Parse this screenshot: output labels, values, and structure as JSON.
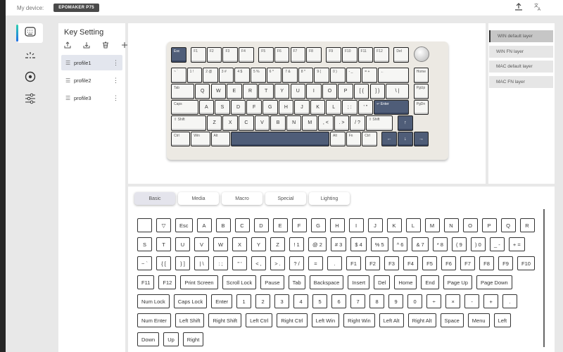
{
  "header": {
    "device_label": "My device:",
    "device_name": "EPOMAKER P75",
    "icons": [
      "upload-icon",
      "translate-icon"
    ]
  },
  "nav": {
    "items": [
      {
        "name": "key-setting",
        "icon": "keyboard-icon",
        "active": true
      },
      {
        "name": "lighting",
        "icon": "light-icon"
      },
      {
        "name": "macro",
        "icon": "record-icon"
      },
      {
        "name": "settings",
        "icon": "sliders-icon"
      }
    ]
  },
  "profiles": {
    "title": "Key Setting",
    "tools": [
      "import-icon",
      "export-icon",
      "delete-icon",
      "add-icon"
    ],
    "items": [
      {
        "label": "profile1",
        "active": true
      },
      {
        "label": "profile2"
      },
      {
        "label": "profile3"
      }
    ]
  },
  "layers": {
    "items": [
      {
        "label": "WIN default layer",
        "active": true
      },
      {
        "label": "WIN FN layer"
      },
      {
        "label": "MAC default layer"
      },
      {
        "label": "MAC FN layer"
      }
    ]
  },
  "keyboard": {
    "rows": [
      [
        {
          "l": "Esc",
          "x": 0,
          "w": 1,
          "dark": true
        },
        {
          "l": "F1",
          "x": 1.25,
          "w": 1
        },
        {
          "l": "F2",
          "x": 2.25,
          "w": 1
        },
        {
          "l": "F3",
          "x": 3.25,
          "w": 1
        },
        {
          "l": "F4",
          "x": 4.25,
          "w": 1
        },
        {
          "l": "F5",
          "x": 5.5,
          "w": 1
        },
        {
          "l": "F6",
          "x": 6.5,
          "w": 1
        },
        {
          "l": "F7",
          "x": 7.5,
          "w": 1
        },
        {
          "l": "F8",
          "x": 8.5,
          "w": 1
        },
        {
          "l": "F9",
          "x": 9.75,
          "w": 1
        },
        {
          "l": "F10",
          "x": 10.75,
          "w": 1
        },
        {
          "l": "F11",
          "x": 11.75,
          "w": 1
        },
        {
          "l": "F12",
          "x": 12.75,
          "w": 1
        },
        {
          "l": "Del",
          "x": 14,
          "w": 1
        }
      ],
      [
        {
          "l": "~ `",
          "x": 0,
          "w": 1
        },
        {
          "l": "1 !",
          "x": 1,
          "w": 1
        },
        {
          "l": "2 @",
          "x": 2,
          "w": 1
        },
        {
          "l": "3 #",
          "x": 3,
          "w": 1
        },
        {
          "l": "4 $",
          "x": 4,
          "w": 1
        },
        {
          "l": "5 %",
          "x": 5,
          "w": 1
        },
        {
          "l": "6 ^",
          "x": 6,
          "w": 1
        },
        {
          "l": "7 &",
          "x": 7,
          "w": 1
        },
        {
          "l": "8 *",
          "x": 8,
          "w": 1
        },
        {
          "l": "9 (",
          "x": 9,
          "w": 1
        },
        {
          "l": "0 )",
          "x": 10,
          "w": 1
        },
        {
          "l": "- _",
          "x": 11,
          "w": 1
        },
        {
          "l": "= +",
          "x": 12,
          "w": 1
        },
        {
          "l": "←",
          "x": 13,
          "w": 2
        },
        {
          "l": "Home",
          "x": 15.25,
          "w": 1
        }
      ],
      [
        {
          "l": "Tab",
          "x": 0,
          "w": 1.5
        },
        {
          "l": "Q",
          "x": 1.5,
          "w": 1,
          "c": true
        },
        {
          "l": "W",
          "x": 2.5,
          "w": 1,
          "c": true
        },
        {
          "l": "E",
          "x": 3.5,
          "w": 1,
          "c": true
        },
        {
          "l": "R",
          "x": 4.5,
          "w": 1,
          "c": true
        },
        {
          "l": "T",
          "x": 5.5,
          "w": 1,
          "c": true
        },
        {
          "l": "Y",
          "x": 6.5,
          "w": 1,
          "c": true
        },
        {
          "l": "U",
          "x": 7.5,
          "w": 1,
          "c": true
        },
        {
          "l": "I",
          "x": 8.5,
          "w": 1,
          "c": true
        },
        {
          "l": "O",
          "x": 9.5,
          "w": 1,
          "c": true
        },
        {
          "l": "P",
          "x": 10.5,
          "w": 1,
          "c": true
        },
        {
          "l": "[ {",
          "x": 11.5,
          "w": 1,
          "c": true
        },
        {
          "l": "] }",
          "x": 12.5,
          "w": 1,
          "c": true
        },
        {
          "l": "\\ |",
          "x": 13.5,
          "w": 1.5,
          "c": true
        },
        {
          "l": "PgUp",
          "x": 15.25,
          "w": 1
        }
      ],
      [
        {
          "l": "Caps",
          "x": 0,
          "w": 1.75
        },
        {
          "l": "A",
          "x": 1.75,
          "w": 1,
          "c": true
        },
        {
          "l": "S",
          "x": 2.75,
          "w": 1,
          "c": true
        },
        {
          "l": "D",
          "x": 3.75,
          "w": 1,
          "c": true
        },
        {
          "l": "F",
          "x": 4.75,
          "w": 1,
          "c": true
        },
        {
          "l": "G",
          "x": 5.75,
          "w": 1,
          "c": true
        },
        {
          "l": "H",
          "x": 6.75,
          "w": 1,
          "c": true
        },
        {
          "l": "J",
          "x": 7.75,
          "w": 1,
          "c": true
        },
        {
          "l": "K",
          "x": 8.75,
          "w": 1,
          "c": true
        },
        {
          "l": "L",
          "x": 9.75,
          "w": 1,
          "c": true
        },
        {
          "l": "; :",
          "x": 10.75,
          "w": 1,
          "c": true
        },
        {
          "l": "' \"",
          "x": 11.75,
          "w": 1,
          "c": true
        },
        {
          "l": "↵ Enter",
          "x": 12.75,
          "w": 2.25,
          "dark": true
        },
        {
          "l": "PgDn",
          "x": 15.25,
          "w": 1
        }
      ],
      [
        {
          "l": "⇧ Shift",
          "x": 0,
          "w": 2.25
        },
        {
          "l": "Z",
          "x": 2.25,
          "w": 1,
          "c": true
        },
        {
          "l": "X",
          "x": 3.25,
          "w": 1,
          "c": true
        },
        {
          "l": "C",
          "x": 4.25,
          "w": 1,
          "c": true
        },
        {
          "l": "V",
          "x": 5.25,
          "w": 1,
          "c": true
        },
        {
          "l": "B",
          "x": 6.25,
          "w": 1,
          "c": true
        },
        {
          "l": "N",
          "x": 7.25,
          "w": 1,
          "c": true
        },
        {
          "l": "M",
          "x": 8.25,
          "w": 1,
          "c": true
        },
        {
          "l": ", <",
          "x": 9.25,
          "w": 1,
          "c": true
        },
        {
          "l": ". >",
          "x": 10.25,
          "w": 1,
          "c": true
        },
        {
          "l": "/ ?",
          "x": 11.25,
          "w": 1,
          "c": true
        },
        {
          "l": "⇧ Shift",
          "x": 12.25,
          "w": 1.75
        },
        {
          "l": "↑",
          "x": 14.25,
          "w": 1,
          "dark": true,
          "c": true
        }
      ],
      [
        {
          "l": "Ctrl",
          "x": 0,
          "w": 1.25
        },
        {
          "l": "Win",
          "x": 1.25,
          "w": 1.25
        },
        {
          "l": "Alt",
          "x": 2.5,
          "w": 1.25
        },
        {
          "l": "",
          "x": 3.75,
          "w": 6.25,
          "dark": true
        },
        {
          "l": "Alt",
          "x": 10,
          "w": 1
        },
        {
          "l": "Fn",
          "x": 11,
          "w": 1
        },
        {
          "l": "Ctrl",
          "x": 12,
          "w": 1
        },
        {
          "l": "←",
          "x": 13.25,
          "w": 1,
          "dark": true,
          "c": true
        },
        {
          "l": "↓",
          "x": 14.25,
          "w": 1,
          "dark": true,
          "c": true
        },
        {
          "l": "→",
          "x": 15.25,
          "w": 1,
          "dark": true,
          "c": true
        }
      ]
    ]
  },
  "keys_panel": {
    "tabs": [
      {
        "label": "Basic",
        "active": true
      },
      {
        "label": "Media"
      },
      {
        "label": "Macro"
      },
      {
        "label": "Special"
      },
      {
        "label": "Lighting"
      }
    ],
    "rows": [
      [
        "",
        "▽",
        "Esc",
        "A",
        "B",
        "C",
        "D",
        "E",
        "F",
        "G",
        "H",
        "I",
        "J",
        "K",
        "L",
        "M",
        "N",
        "O",
        "P",
        "Q",
        "R"
      ],
      [
        "S",
        "T",
        "U",
        "V",
        "W",
        "X",
        "Y",
        "Z",
        "! 1",
        "@ 2",
        "# 3",
        "$ 4",
        "% 5",
        "^ 6",
        "& 7",
        "* 8",
        "( 9",
        ") 0",
        "_ -",
        "+ ="
      ],
      [
        "~ `",
        "{ [",
        "} ]",
        "| \\",
        ": ;",
        "\" '",
        "< ,",
        "> .",
        "? /",
        "=",
        ".",
        "F1",
        "F2",
        "F3",
        "F4",
        "F5",
        "F6",
        "F7",
        "F8",
        "F9",
        "F10"
      ],
      [
        "F11",
        "F12",
        "Print Screen",
        "Scroll Lock",
        "Pause",
        "Tab",
        "Backspace",
        "Insert",
        "Del",
        "Home",
        "End",
        "Page Up",
        "Page Down"
      ],
      [
        "Num Lock",
        "Caps Lock",
        "Enter",
        "1",
        "2",
        "3",
        "4",
        "5",
        "6",
        "7",
        "8",
        "9",
        "0",
        "÷",
        "×",
        "-",
        "+",
        "."
      ],
      [
        "Num Enter",
        "Left Shift",
        "Right Shift",
        "Left Ctrl",
        "Right Ctrl",
        "Left Win",
        "Right Win",
        "Left Alt",
        "Right Alt",
        "Space",
        "Menu",
        "Left"
      ],
      [
        "Down",
        "Up",
        "Right"
      ]
    ]
  }
}
